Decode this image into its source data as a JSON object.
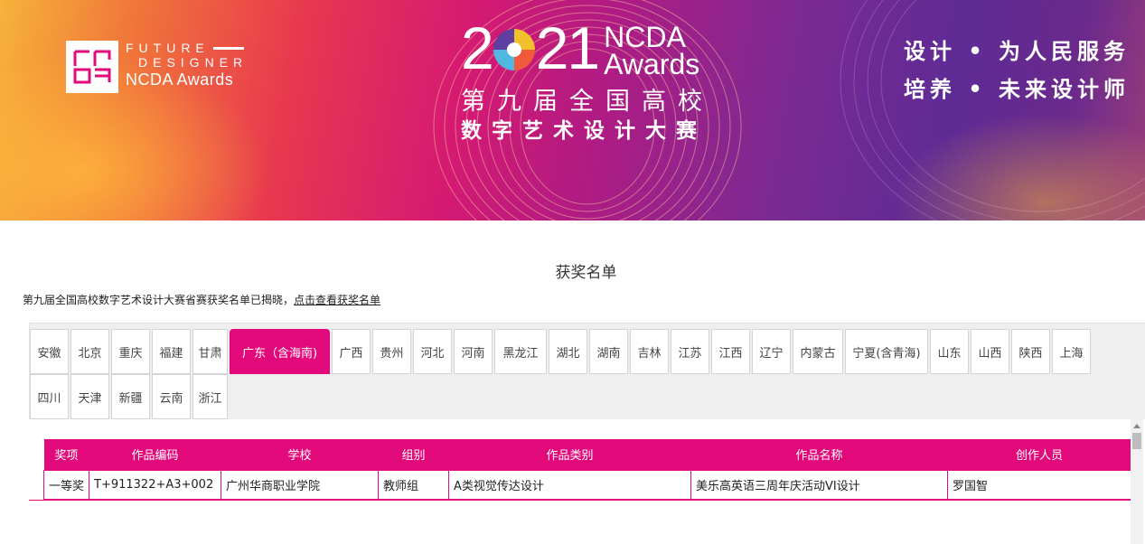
{
  "banner": {
    "logo": {
      "line1": "FUTURE",
      "line2": "DESIGNER",
      "line3": "NCDA Awards"
    },
    "year_prefix": "2",
    "year_suffix": "21",
    "ncda_line1": "NCDA",
    "ncda_line2": "Awards",
    "cn_line1": "第九届全国高校",
    "cn_line2": "数字艺术设计大赛",
    "slogan_line1": "设计 • 为人民服务",
    "slogan_line2": "培养 • 未来设计师"
  },
  "page_title": "获奖名单",
  "intro": {
    "text": "第九届全国高校数字艺术设计大赛省赛获奖名单已揭晓，",
    "link": "点击查看获奖名单"
  },
  "tabs_row1": [
    "安徽",
    "北京",
    "重庆",
    "福建",
    "甘肃",
    "广东（含海南)",
    "广西",
    "贵州",
    "河北",
    "河南",
    "黑龙江",
    "湖北",
    "湖南",
    "吉林",
    "江苏",
    "江西",
    "辽宁",
    "内蒙古",
    "宁夏(含青海)",
    "山东",
    "山西",
    "陕西",
    "上海"
  ],
  "tabs_row2": [
    "四川",
    "天津",
    "新疆",
    "云南",
    "浙江"
  ],
  "active_tab": "广东（含海南)",
  "table": {
    "headers": [
      "奖项",
      "作品编码",
      "学校",
      "组别",
      "作品类别",
      "作品名称",
      "创作人员"
    ],
    "rows": [
      [
        "一等奖",
        "T+911322+A3+002",
        "广州华商职业学院",
        "教师组",
        "A类视觉传达设计",
        "美乐高英语三周年庆活动VI设计",
        "罗国智"
      ]
    ]
  },
  "colors": {
    "accent": "#e2097a"
  }
}
